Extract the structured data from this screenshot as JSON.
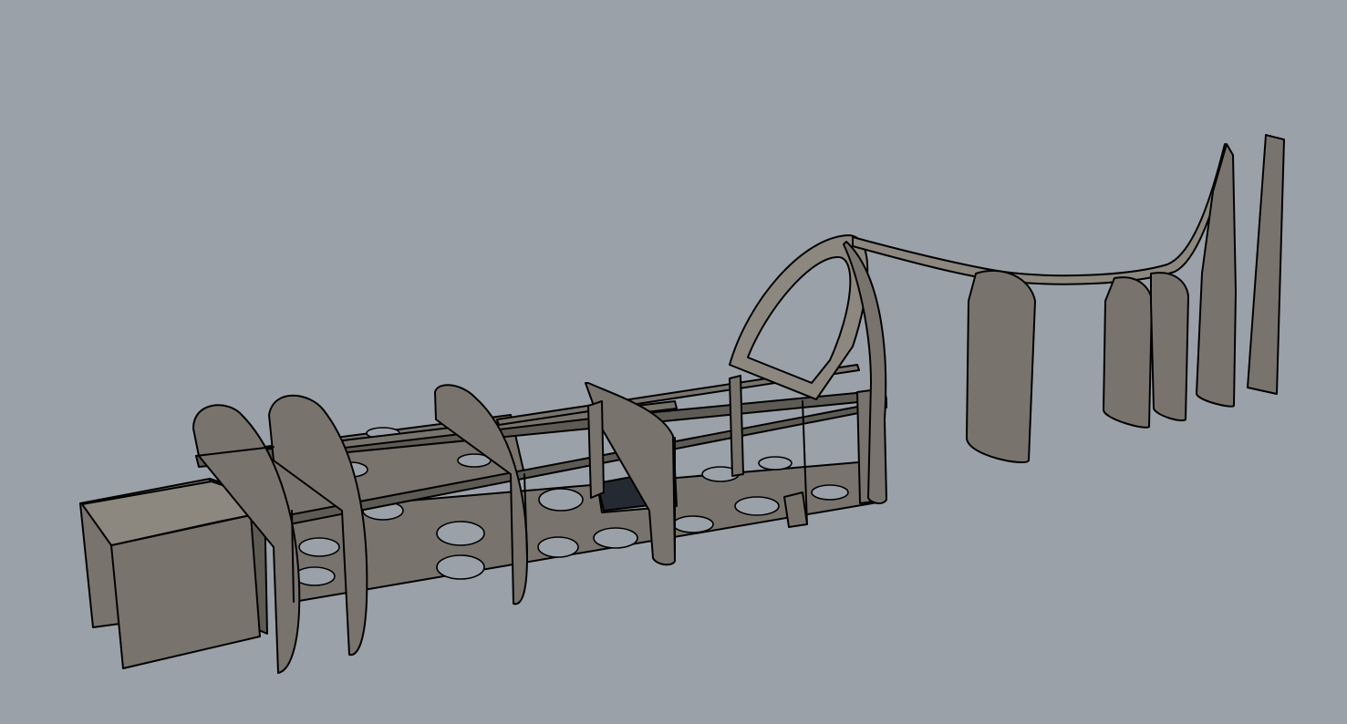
{
  "viewport": {
    "background": "#9ba1a9",
    "part_fill": "#78746d",
    "part_fill_light": "#8c887f",
    "part_fill_dark": "#5e5b55",
    "edge_color": "#000000",
    "hole_color": "#1b1e24"
  },
  "model": {
    "icon": "fuselage-frame-wireframe"
  }
}
